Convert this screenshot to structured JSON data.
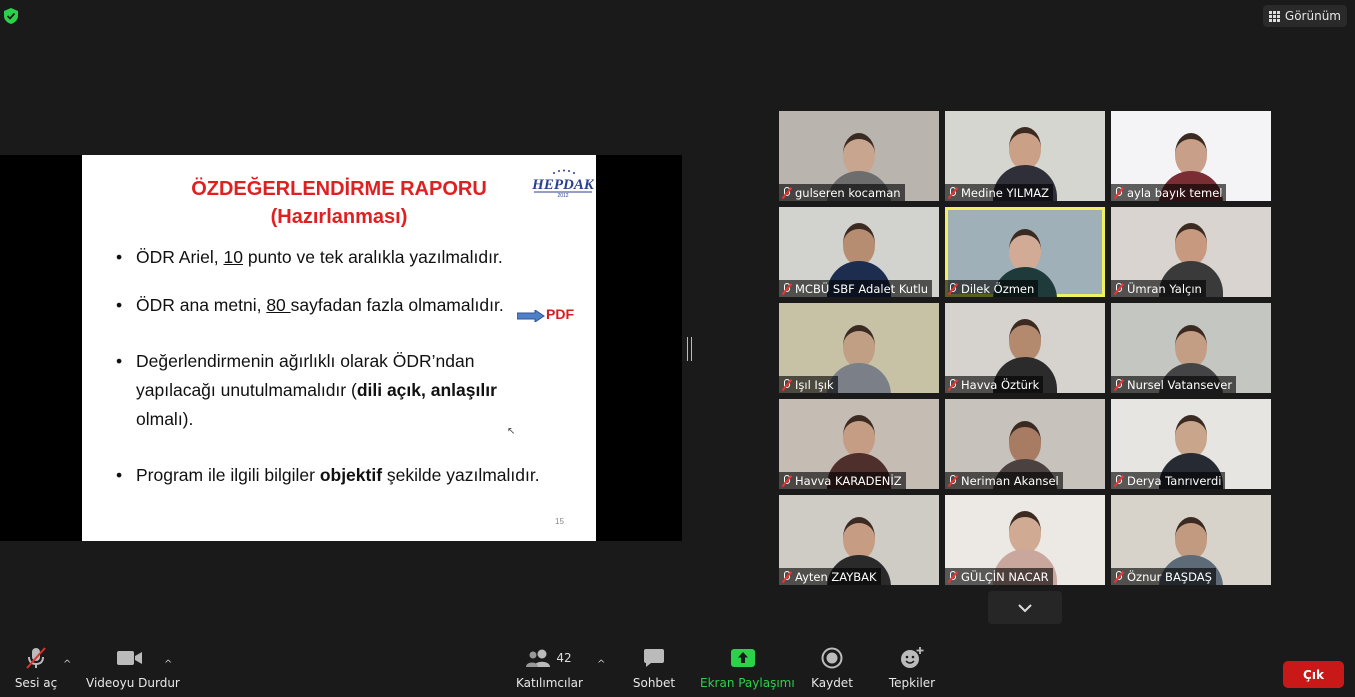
{
  "top": {
    "view_button": "Görünüm"
  },
  "slide": {
    "title_line1": "ÖZDEĞERLENDİRME RAPORU",
    "title_line2": "(Hazırlanması)",
    "logo_text": "HEPDAK",
    "logo_year": "2012",
    "bullet1": {
      "a": "ÖDR  Ariel, ",
      "num": "10",
      "b": " punto ve tek aralıkla yazılmalıdır."
    },
    "bullet2": {
      "a": "ÖDR ana metni, ",
      "num": "80 ",
      "b": "sayfadan fazla olmamalıdır."
    },
    "bullet3": {
      "line1": "Değerlendirmenin  ağırlıklı olarak ÖDR’ndan",
      "line2a": "yapılacağı unutulmamalıdır (",
      "line2b": "dili açık, anlaşılır",
      "line3": "olmalı)."
    },
    "bullet4": {
      "a": "Program ile ilgili bilgiler ",
      "bold": "objektif",
      "b": " şekilde yazılmalıdır."
    },
    "pdf_label": "PDF",
    "page_number": "15"
  },
  "participants": [
    {
      "name": "gulseren kocaman",
      "bg": "#b9b4ad",
      "skin": "#c7a58f",
      "shirt": "#6d6d6d"
    },
    {
      "name": "Medine YILMAZ",
      "bg": "#d6d6d0",
      "skin": "#caa187",
      "shirt": "#2f2f3a"
    },
    {
      "name": "ayla bayık temel",
      "bg": "#f4f4f6",
      "skin": "#c8a08a",
      "shirt": "#7a2e34"
    },
    {
      "name": "MCBÜ SBF Adalet Kutlu",
      "bg": "#d2d2cf",
      "skin": "#b78d72",
      "shirt": "#1d2d4f"
    },
    {
      "name": "Dilek Özmen",
      "bg": "#9fb0b8",
      "skin": "#d1ab95",
      "shirt": "#1f3a3a"
    },
    {
      "name": "Ümran Yalçın",
      "bg": "#d9d4d0",
      "skin": "#c79a80",
      "shirt": "#3a3a3a"
    },
    {
      "name": "Işıl Işık",
      "bg": "#c7c2a6",
      "skin": "#c19f85",
      "shirt": "#7a7f88"
    },
    {
      "name": "Havva Öztürk",
      "bg": "#d6d3cf",
      "skin": "#b38a6e",
      "shirt": "#2b2b2b"
    },
    {
      "name": "Nursel Vatansever",
      "bg": "#c4c6c2",
      "skin": "#c49d85",
      "shirt": "#444446"
    },
    {
      "name": "Havva KARADENİZ",
      "bg": "#c5bcb4",
      "skin": "#c59d84",
      "shirt": "#4f2f2b"
    },
    {
      "name": "Neriman Akansel",
      "bg": "#c7c2bc",
      "skin": "#a87c62",
      "shirt": "#4b4141"
    },
    {
      "name": "Derya Tanrıverdi",
      "bg": "#e6e5e1",
      "skin": "#c9a58b",
      "shirt": "#262a33"
    },
    {
      "name": "Ayten ZAYBAK",
      "bg": "#cfccc5",
      "skin": "#c69c82",
      "shirt": "#2a2a2a"
    },
    {
      "name": "GÜLÇİN NACAR",
      "bg": "#ece8e4",
      "skin": "#d0aa93",
      "shirt": "#caa79c"
    },
    {
      "name": "Öznur BAŞDAŞ",
      "bg": "#d7d3cb",
      "skin": "#c29a7f",
      "shirt": "#5d6a78"
    }
  ],
  "toolbar": {
    "mute_label": "Sesi aç",
    "video_label": "Videoyu Durdur",
    "participants_label": "Katılımcılar",
    "participants_count": "42",
    "chat_label": "Sohbet",
    "share_label": "Ekran Paylaşımı",
    "record_label": "Kaydet",
    "reactions_label": "Tepkiler",
    "exit_label": "Çık"
  },
  "colors": {
    "share_green": "#2bd14a",
    "exit_red": "#c81818",
    "active_speaker": "#f0f060"
  }
}
